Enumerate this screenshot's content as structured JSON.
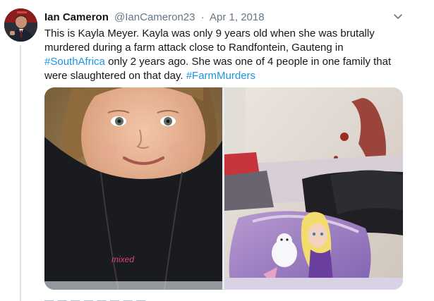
{
  "tweet": {
    "author_name": "Ian Cameron",
    "handle": "@IanCameron23",
    "separator": "·",
    "date": "Apr 1, 2018",
    "text_lines": [
      "This is Kayla Meyer. Kayla was only 9 years old when she was brutally",
      "murdered during a farm attack close to Randfontein, Gauteng in",
      "only 2 years ago. She was one of 4 people in one family that",
      "were slaughtered on that day."
    ],
    "hashtags": [
      "#SouthAfrica",
      "#FarmMurders"
    ],
    "shirt_print": "mixed"
  },
  "colors": {
    "link": "#1b95e0",
    "secondary_text": "#657786",
    "thread_line": "#dbe3ea"
  },
  "icons": {
    "avatar": "user-avatar-photo",
    "caret": "chevron-down-icon"
  }
}
